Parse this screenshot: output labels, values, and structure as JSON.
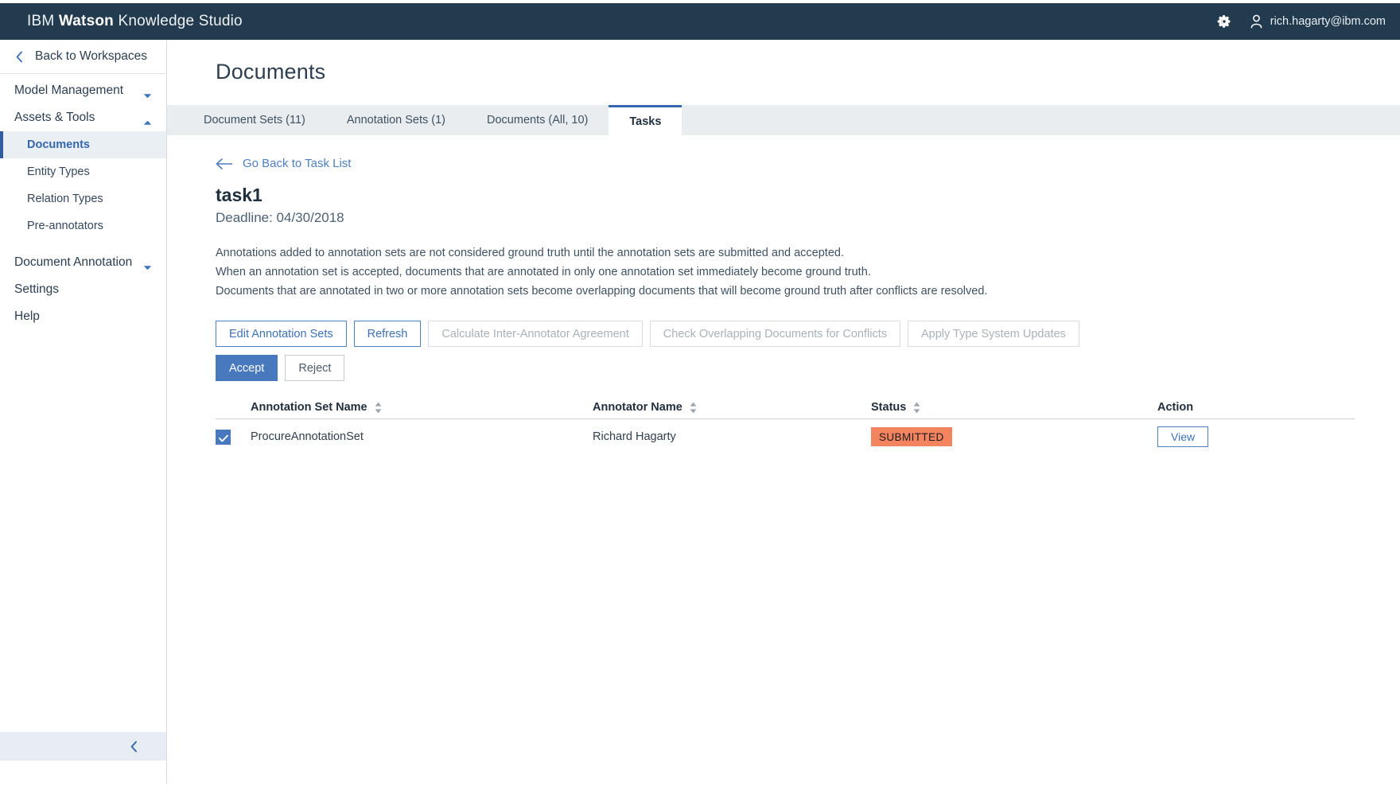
{
  "topbar": {
    "brand_prefix": "IBM ",
    "brand_bold": "Watson",
    "brand_suffix": " Knowledge Studio",
    "gear_icon": "gear-icon",
    "user_icon": "user-icon",
    "user_email": "rich.hagarty@ibm.com",
    "background": "#223b4f"
  },
  "sidebar": {
    "back_label": "Back to Workspaces",
    "back_icon": "chevron-left-icon",
    "collapse_icon": "chevron-left-icon",
    "groups": [
      {
        "label": "Model Management",
        "icon": "chevron-down-icon",
        "expanded": false
      },
      {
        "label": "Assets & Tools",
        "icon": "chevron-up-icon",
        "expanded": true
      }
    ],
    "items": [
      {
        "label": "Documents",
        "active": true
      },
      {
        "label": "Entity Types",
        "active": false
      },
      {
        "label": "Relation Types",
        "active": false
      },
      {
        "label": "Pre-annotators",
        "active": false
      }
    ],
    "groups2": [
      {
        "label": "Document Annotation",
        "icon": "chevron-down-icon"
      }
    ],
    "links": [
      {
        "label": "Settings"
      },
      {
        "label": "Help"
      }
    ],
    "active_color": "#3566b0"
  },
  "main": {
    "page_title": "Documents",
    "tabs": [
      {
        "label": "Document Sets (11)",
        "active": false
      },
      {
        "label": "Annotation Sets (1)",
        "active": false
      },
      {
        "label": "Documents (All, 10)",
        "active": false
      },
      {
        "label": "Tasks",
        "active": true
      }
    ],
    "go_back_label": "Go Back to Task List",
    "go_back_icon": "arrow-left-icon",
    "task_name": "task1",
    "deadline": "Deadline: 04/30/2018",
    "description": [
      "Annotations added to annotation sets are not considered ground truth until the annotation sets are submitted and accepted.",
      "When an annotation set is accepted, documents that are annotated in only one annotation set immediately become ground truth.",
      "Documents that are annotated in two or more annotation sets become overlapping documents that will become ground truth after conflicts are resolved."
    ],
    "actions": [
      {
        "label": "Edit Annotation Sets",
        "state": "enabled"
      },
      {
        "label": "Refresh",
        "state": "enabled"
      },
      {
        "label": "Calculate Inter-Annotator Agreement",
        "state": "disabled"
      },
      {
        "label": "Check Overlapping Documents for Conflicts",
        "state": "disabled"
      },
      {
        "label": "Apply Type System Updates",
        "state": "disabled"
      }
    ],
    "decisions": [
      {
        "label": "Accept",
        "style": "primary"
      },
      {
        "label": "Reject",
        "style": "plain"
      }
    ],
    "table": {
      "headers": [
        {
          "label": "Annotation Set Name",
          "sortable": true,
          "sort_icon": "sort-arrows-icon"
        },
        {
          "label": "Annotator Name",
          "sortable": true,
          "sort_icon": "sort-arrows-icon"
        },
        {
          "label": "Status",
          "sortable": true,
          "sort_icon": "sort-arrows-icon"
        },
        {
          "label": "Action",
          "sortable": false
        }
      ],
      "rows": [
        {
          "checked": true,
          "check_icon": "checkmark-icon",
          "name": "ProcureAnnotationSet",
          "annotator": "Richard Hagarty",
          "status": "SUBMITTED",
          "status_color": "#f4845f",
          "action_label": "View"
        }
      ]
    }
  }
}
